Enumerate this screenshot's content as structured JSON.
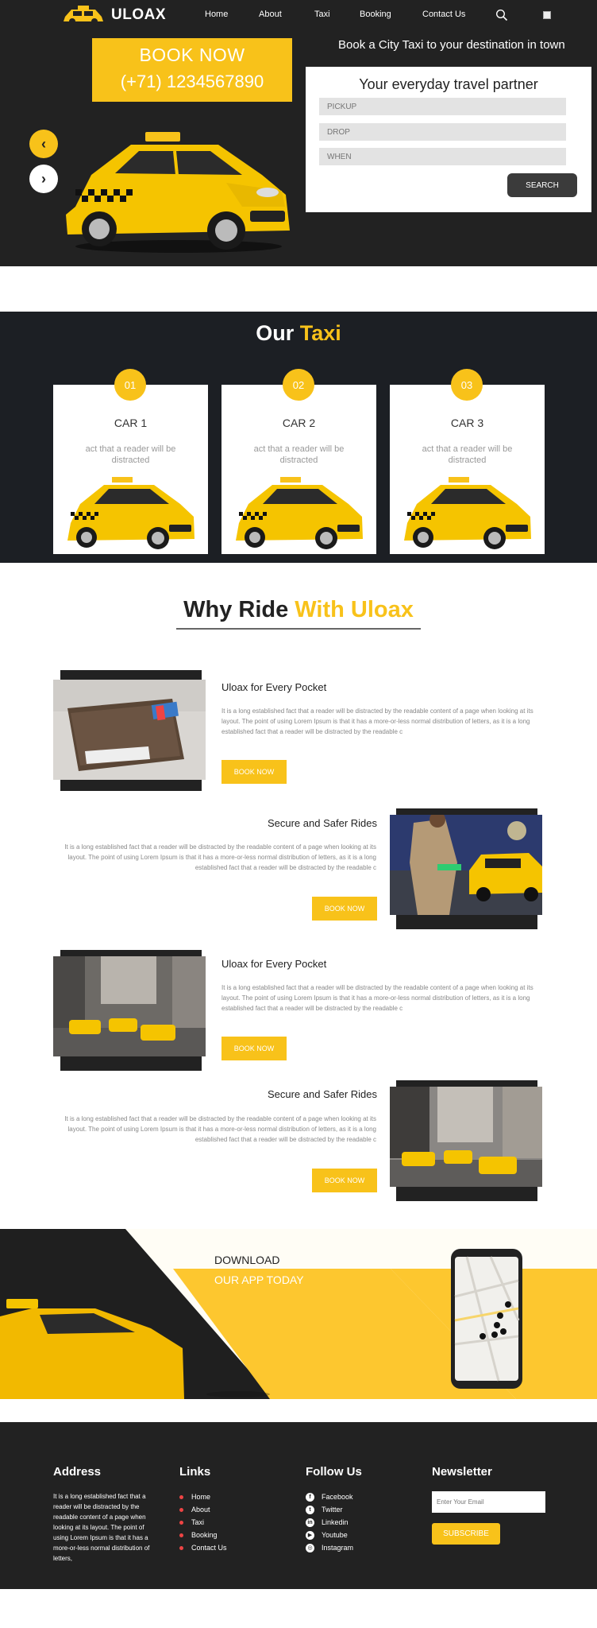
{
  "brand": {
    "name": "ULOAX"
  },
  "nav": {
    "items": [
      "Home",
      "About",
      "Taxi",
      "Booking",
      "Contact Us"
    ]
  },
  "hero": {
    "book_now": "BOOK NOW",
    "phone": "(+71) 1234567890",
    "tagline": "Book a City Taxi to your destination in town",
    "form_title": "Your everyday travel partner",
    "pickup_placeholder": "PICKUP",
    "drop_placeholder": "DROP",
    "when_placeholder": "WHEN",
    "search_label": "SEARCH",
    "prev_arrow": "‹",
    "next_arrow": "›"
  },
  "our_taxi": {
    "title_main": "Our",
    "title_highlight": "Taxi",
    "cars": [
      {
        "num": "01",
        "name": "CAR 1",
        "desc": "act that a reader will be distracted"
      },
      {
        "num": "02",
        "name": "CAR 2",
        "desc": "act that a reader will be distracted"
      },
      {
        "num": "03",
        "name": "CAR 3",
        "desc": "act that a reader will be distracted"
      }
    ]
  },
  "why": {
    "title_main": "Why Ride",
    "title_highlight": "With Uloax",
    "features": [
      {
        "title": "Uloax for Every Pocket",
        "text": "It is a long established fact that a reader will be distracted by the readable content of a page when looking at its layout. The point of using Lorem Ipsum is that it has a more-or-less normal distribution of letters, as it is a long established fact that a reader will be distracted by the readable c",
        "button": "BOOK NOW"
      },
      {
        "title": "Secure and Safer Rides",
        "text": "It is a long established fact that a reader will be distracted by the readable content of a page when looking at its layout. The point of using Lorem Ipsum is that it has a more-or-less normal distribution of letters, as it is a long established fact that a reader will be distracted by the readable c",
        "button": "BOOK NOW"
      },
      {
        "title": "Uloax for Every Pocket",
        "text": "It is a long established fact that a reader will be distracted by the readable content of a page when looking at its layout. The point of using Lorem Ipsum is that it has a more-or-less normal distribution of letters, as it is a long established fact that a reader will be distracted by the readable c",
        "button": "BOOK NOW"
      },
      {
        "title": "Secure and Safer Rides",
        "text": "It is a long established fact that a reader will be distracted by the readable content of a page when looking at its layout. The point of using Lorem Ipsum is that it has a more-or-less normal distribution of letters, as it is a long established fact that a reader will be distracted by the readable c",
        "button": "BOOK NOW"
      }
    ]
  },
  "download": {
    "title": "DOWNLOAD",
    "subtitle": "OUR APP TODAY"
  },
  "footer": {
    "address_title": "Address",
    "address_text": "It is a long established fact that a reader will be distracted by the readable content of a page when looking at its layout. The point of using Lorem Ipsum is that it has a more-or-less normal distribution of letters,",
    "links_title": "Links",
    "links": [
      "Home",
      "About",
      "Taxi",
      "Booking",
      "Contact Us"
    ],
    "follow_title": "Follow Us",
    "social": [
      {
        "label": "Facebook",
        "icon": "facebook-icon"
      },
      {
        "label": "Twitter",
        "icon": "twitter-icon"
      },
      {
        "label": "Linkedin",
        "icon": "linkedin-icon"
      },
      {
        "label": "Youtube",
        "icon": "youtube-icon"
      },
      {
        "label": "Instagram",
        "icon": "instagram-icon"
      }
    ],
    "newsletter_title": "Newsletter",
    "email_placeholder": "Enter Your Email",
    "subscribe_label": "SUBSCRIBE"
  },
  "colors": {
    "accent": "#f8c21a",
    "dark": "#222222",
    "navy": "#1c1f24"
  }
}
